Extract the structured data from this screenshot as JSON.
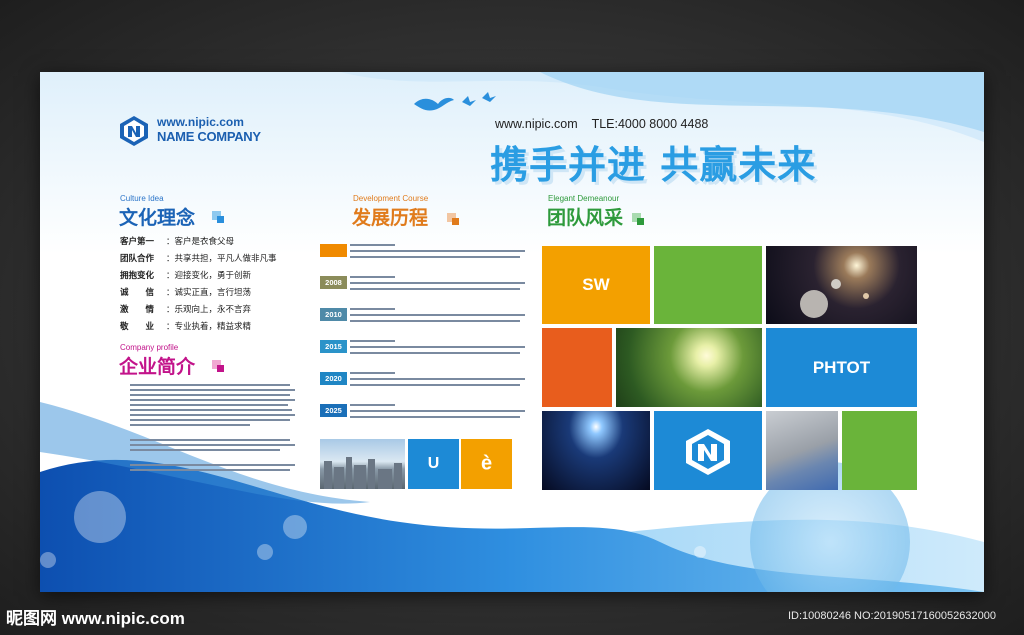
{
  "header": {
    "logo_url": "www.nipic.com",
    "logo_company": "NAME COMPANY",
    "contact_url": "www.nipic.com",
    "contact_tel": "TLE:4000 8000 4488",
    "slogan": "携手并进 共赢未来"
  },
  "culture": {
    "en": "Culture Idea",
    "title": "文化理念",
    "rows": [
      {
        "key": "客户第一",
        "val": "：客户是衣食父母"
      },
      {
        "key": "团队合作",
        "val": "：共享共担，平凡人做非凡事"
      },
      {
        "key": "拥抱变化",
        "val": "：迎接变化，勇于创新"
      },
      {
        "key": "诚　　信",
        "val": "：诚实正直，言行坦荡"
      },
      {
        "key": "激　　情",
        "val": "：乐观向上，永不言弃"
      },
      {
        "key": "敬　　业",
        "val": "：专业执着，精益求精"
      }
    ]
  },
  "profile": {
    "en": "Company profile",
    "title": "企业简介"
  },
  "development": {
    "en": "Development Course",
    "title": "发展历程",
    "items": [
      {
        "year": "",
        "color": "#f08a00"
      },
      {
        "year": "2008",
        "color": "#8b8c5a"
      },
      {
        "year": "2010",
        "color": "#4f8aa8"
      },
      {
        "year": "2015",
        "color": "#2a93c9"
      },
      {
        "year": "2020",
        "color": "#1f86c4"
      },
      {
        "year": "2025",
        "color": "#1a6fb8"
      }
    ],
    "bottom_tiles": {
      "u_label": "U",
      "e_label": "è"
    }
  },
  "team": {
    "en": "Elegant Demeanour",
    "title": "团队风采",
    "sw_label": "SW",
    "phtot_label": "PHTOT"
  },
  "colors": {
    "blue": "#1d8ad6",
    "orange": "#f3a000",
    "green": "#6ab43a",
    "red_orange": "#e85d1d",
    "title_green": "#2e9a3c",
    "title_orange": "#e07b1c",
    "title_magenta": "#c2138a",
    "title_blue": "#1b63b6"
  },
  "footer": {
    "brand": "昵图网 www.nipic.com",
    "id_text": "ID:10080246 NO:20190517160052632000"
  }
}
